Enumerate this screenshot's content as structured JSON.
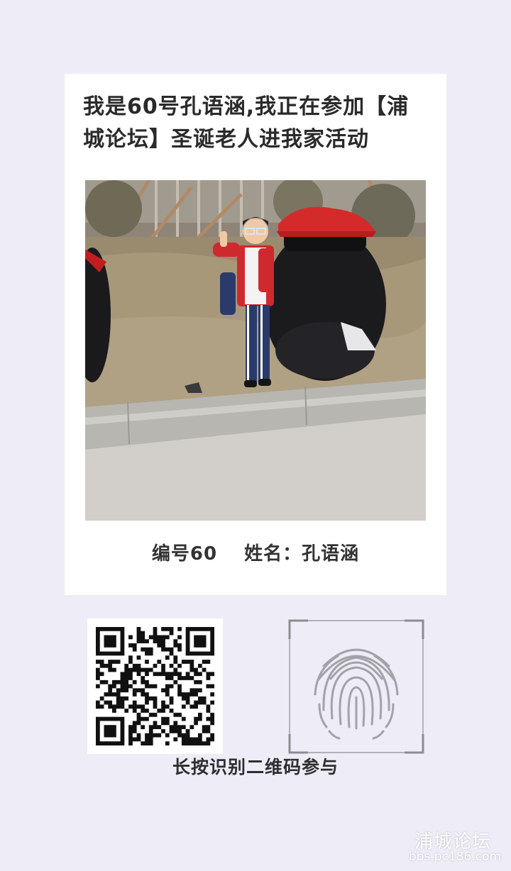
{
  "card": {
    "title": "我是60号孔语涵,我正在参加【浦城论坛】圣诞老人进我家活动",
    "number_label": "编号60",
    "name_label": "姓名：孔语涵"
  },
  "qr": {
    "icon": "qr-code-icon"
  },
  "fingerprint": {
    "icon": "fingerprint-icon"
  },
  "hint": "长按识别二维码参与",
  "watermark": {
    "name": "浦城论坛",
    "url": "bbs.pc186.com"
  }
}
